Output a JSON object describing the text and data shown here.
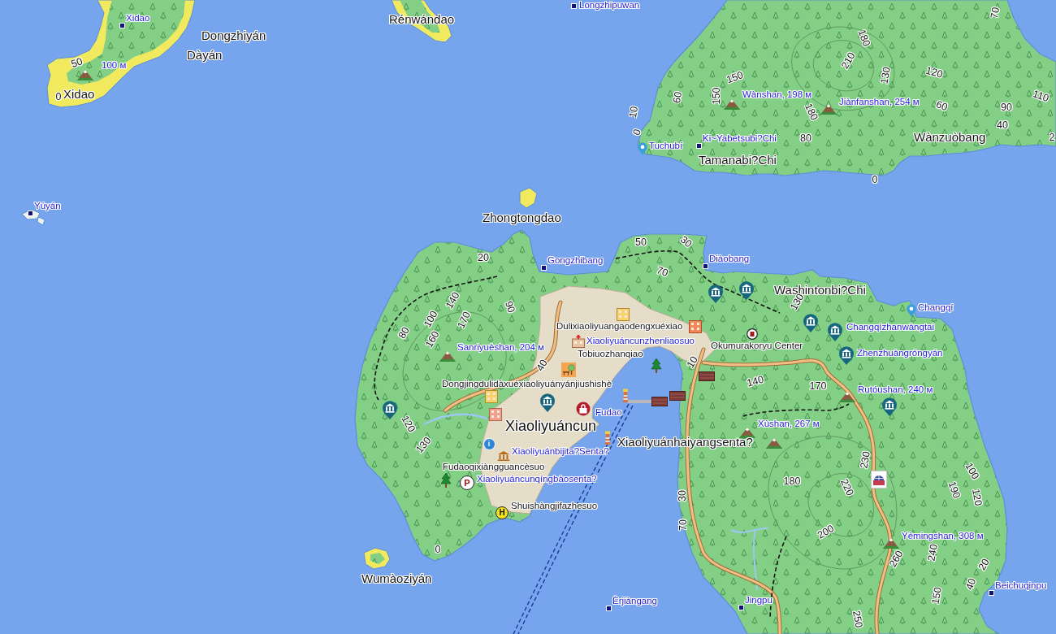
{
  "map": {
    "place_names": [
      "Rénwándao",
      "Dongzhiyán",
      "Dàyán",
      "Xidao",
      "Wànzuòbang",
      "Tamanabi?Chi",
      "Zhongtongdao",
      "Washintonbi?Chi",
      "Xiaoliyuánhaiyangsenta?",
      "Wumàoziyán"
    ],
    "town_name": "Xiaoliyuáncun",
    "localities": [
      {
        "name": "Longzhipuwan",
        "kind": "square"
      },
      {
        "name": "Xidao",
        "kind": "square"
      },
      {
        "name": "Ki~Yabetsubi?Chi",
        "kind": "square"
      },
      {
        "name": "Tuchubí",
        "kind": "pin"
      },
      {
        "name": "Yúyán",
        "kind": "square"
      },
      {
        "name": "Diàobang",
        "kind": "square"
      },
      {
        "name": "Gongzhibang",
        "kind": "square"
      },
      {
        "name": "Changqí",
        "kind": "pin"
      },
      {
        "name": "Beichuqinpu",
        "kind": "square"
      },
      {
        "name": "Èrjiàngang",
        "kind": "square"
      },
      {
        "name": "Jingpu",
        "kind": "square"
      }
    ],
    "peaks": [
      "100 м",
      "Wànshan, 198 м",
      "Jiànfanshan, 254 м",
      "Sanriyuèshan, 204 м",
      "Rutóushan, 240 м",
      "Xùshan, 267 м",
      "Yèmingshan, 308 м"
    ],
    "poi_labels": [
      "Changqízhanwàngtai",
      "Xiaoliyuáncunzhenliaosuo",
      "Zhenzhuàngróngyán",
      "Fudao",
      "Xiaoliyuánbijita?Senta?",
      "Xiaoliyuáncunqíngbàosenta?"
    ],
    "facility_labels": [
      "Dulixiaoliyuangaodengxuéxiao",
      "Okumurakoryu Center",
      "Tobiuozhanqiao",
      "Dongjingdulidàxuéxiaoliyuányánjiushishè",
      "Fudaoqixiàngguancèsuo",
      "Shuishàngjifazhesuo"
    ],
    "signs": [
      {
        "kind": "info",
        "glyph": "i"
      },
      {
        "kind": "parking",
        "glyph": "P"
      },
      {
        "kind": "helipad",
        "glyph": "H"
      }
    ],
    "contour_labels": [
      "50",
      "0",
      "70",
      "180",
      "210",
      "130",
      "120",
      "150",
      "110",
      "60",
      "150",
      "90",
      "60",
      "10",
      "180",
      "40",
      "0",
      "80",
      "2",
      "0",
      "50",
      "20",
      "30",
      "70",
      "140",
      "90",
      "130",
      "100",
      "170",
      "80",
      "160",
      "40",
      "10",
      "140",
      "170",
      "120",
      "130",
      "230",
      "100",
      "180",
      "220",
      "190",
      "120",
      "30",
      "70",
      "200",
      "0",
      "240",
      "260",
      "20",
      "40",
      "150",
      "250"
    ]
  }
}
